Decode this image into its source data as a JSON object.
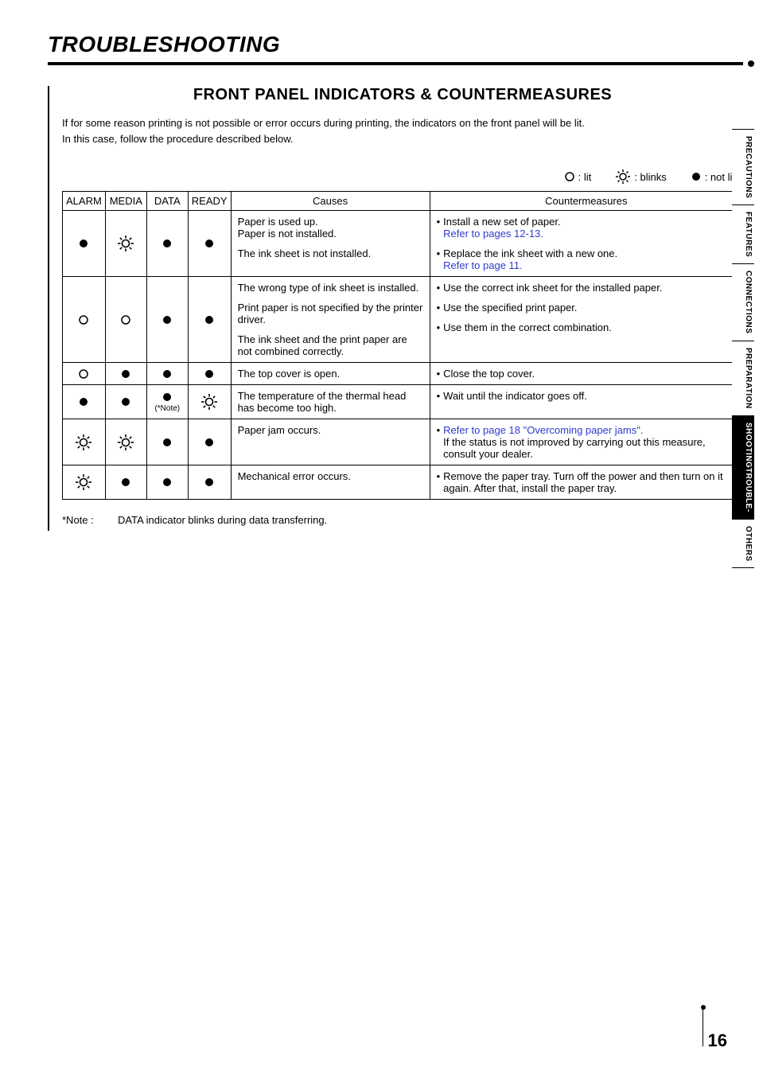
{
  "chapterTitle": "TROUBLESHOOTING",
  "sectionTitle": "FRONT PANEL INDICATORS & COUNTERMEASURES",
  "introLine1": "If for some reason printing is not possible or error occurs during printing, the indicators on the front panel will be lit.",
  "introLine2": "In this case, follow the procedure described below.",
  "legend": {
    "lit": ": lit",
    "blinks": ": blinks",
    "notlit": ": not lit"
  },
  "headers": {
    "alarm": "ALARM",
    "media": "MEDIA",
    "data": "DATA",
    "ready": "READY",
    "causes": "Causes",
    "countermeasures": "Countermeasures"
  },
  "dataNote": "(*Note)",
  "rows": [
    {
      "alarm": "notlit",
      "media": "blinks",
      "data": "notlit",
      "ready": "notlit",
      "causes": [
        {
          "t1": "Paper is used up.",
          "t2": "Paper is not installed."
        },
        {
          "t1": "The ink sheet is not installed."
        }
      ],
      "cms": [
        {
          "lead": "• ",
          "t1": "Install a new set of paper.",
          "ref": "Refer to pages 12-13."
        },
        {
          "lead": "• ",
          "t1": "Replace the ink sheet with a new one.",
          "ref": "Refer to page 11."
        }
      ]
    },
    {
      "alarm": "lit",
      "media": "lit",
      "data": "notlit",
      "ready": "notlit",
      "causes": [
        {
          "t1": "The wrong type of ink sheet is installed."
        },
        {
          "t1": "Print paper is not specified by the printer driver."
        },
        {
          "t1": "The ink sheet and the print paper are not combined correctly."
        }
      ],
      "cms": [
        {
          "lead": "• ",
          "t1": "Use the correct ink sheet for the installed paper."
        },
        {
          "lead": "• ",
          "t1": "Use the specified print paper."
        },
        {
          "lead": "• ",
          "t1": "Use them in the correct combination."
        }
      ]
    },
    {
      "alarm": "lit",
      "media": "notlit",
      "data": "notlit",
      "ready": "notlit",
      "causes": [
        {
          "t1": "The top cover is open."
        }
      ],
      "cms": [
        {
          "lead": "• ",
          "t1": "Close the top cover."
        }
      ]
    },
    {
      "alarm": "notlit",
      "media": "notlit",
      "data": "notlit",
      "dataNote": true,
      "ready": "blinks",
      "causes": [
        {
          "t1": "The temperature of the thermal head has become too high."
        }
      ],
      "cms": [
        {
          "lead": "• ",
          "t1": "Wait until the indicator goes off."
        }
      ]
    },
    {
      "alarm": "blinks",
      "media": "blinks",
      "data": "notlit",
      "ready": "notlit",
      "causes": [
        {
          "t1": "Paper jam occurs."
        }
      ],
      "cms": [
        {
          "lead": "• ",
          "refLead": "Refer to page 18 \"Overcoming paper jams\".",
          "t1": "If the status is not improved by carrying out this measure, consult your dealer."
        }
      ]
    },
    {
      "alarm": "blinks",
      "media": "notlit",
      "data": "notlit",
      "ready": "notlit",
      "causes": [
        {
          "t1": "Mechanical error occurs."
        }
      ],
      "cms": [
        {
          "lead": "• ",
          "t1": "Remove the paper tray. Turn off the power and then turn on it again. After that, install the paper tray."
        }
      ]
    }
  ],
  "footnoteLabel": "*Note :",
  "footnoteText": "DATA indicator blinks during data transferring.",
  "tabs": {
    "precautions": "PRECAUTIONS",
    "features": "FEATURES",
    "connections": "CONNECTIONS",
    "preparation": "PREPARATION",
    "troubleA": "TROUBLE-",
    "troubleB": "SHOOTING",
    "others": "OTHERS"
  },
  "pageNumber": "16"
}
